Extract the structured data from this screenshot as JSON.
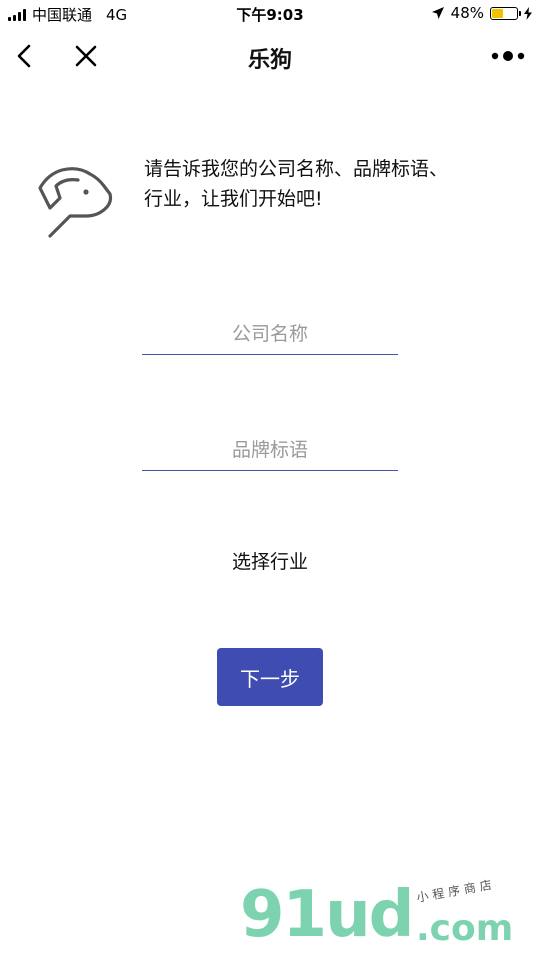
{
  "status_bar": {
    "carrier": "中国联通",
    "network": "4G",
    "time": "下午9:03",
    "battery_percent": "48%",
    "battery_level": 0.48
  },
  "nav": {
    "title": "乐狗"
  },
  "intro": {
    "text": "请告诉我您的公司名称、品牌标语、行业，让我们开始吧!"
  },
  "form": {
    "company_placeholder": "公司名称",
    "slogan_placeholder": "品牌标语",
    "industry_label": "选择行业",
    "next_label": "下一步"
  },
  "watermark": {
    "main": "91ud",
    "domain": ".com",
    "tagline": "小程序商店"
  },
  "colors": {
    "accent": "#3f4db3",
    "underline": "#4a52a8",
    "watermark": "#7dd3b0",
    "battery": "#f2c200"
  }
}
